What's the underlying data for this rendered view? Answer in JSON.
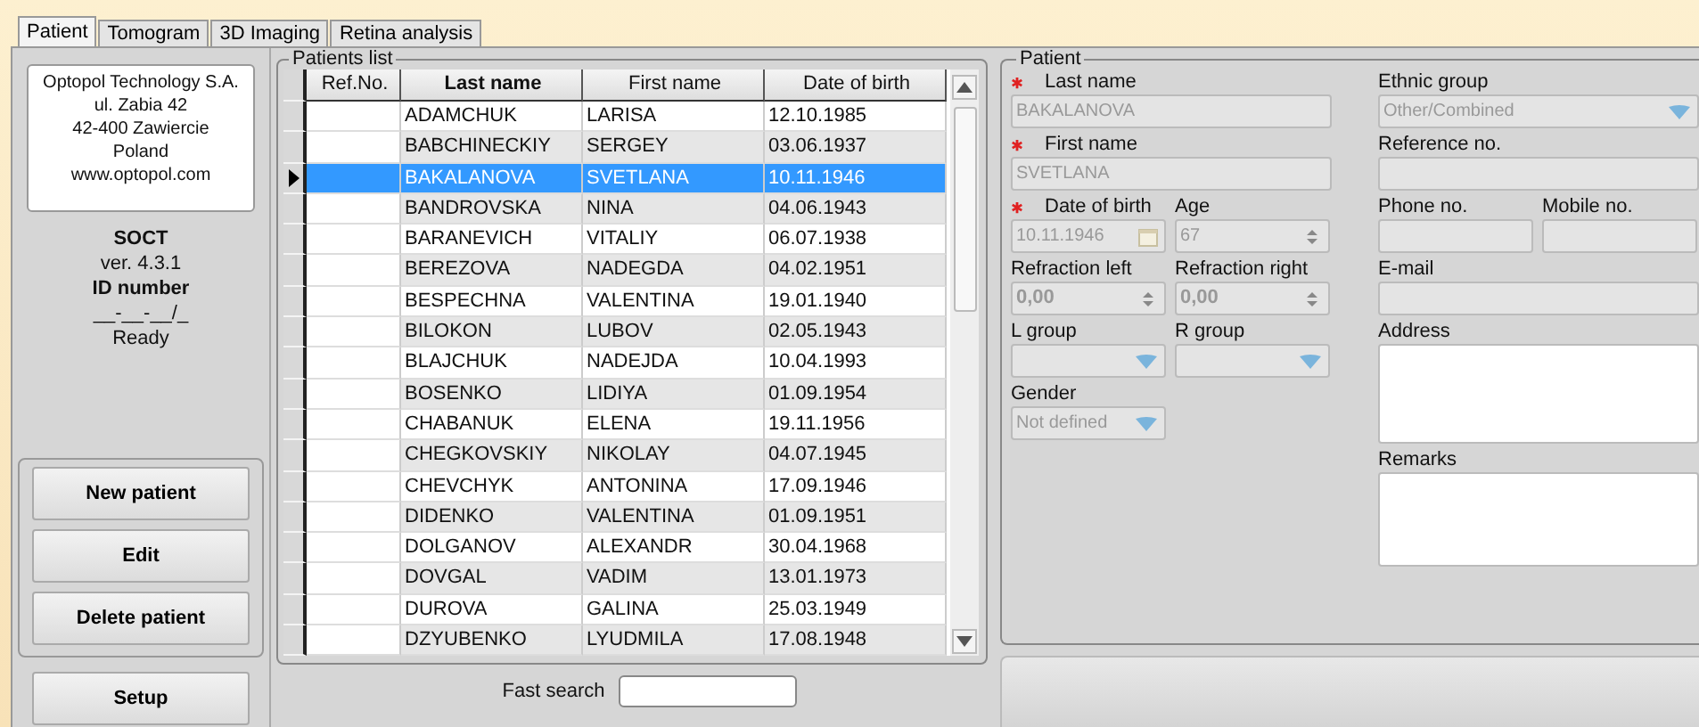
{
  "tabs": [
    {
      "label": "Patient",
      "selected": true
    },
    {
      "label": "Tomogram",
      "selected": false
    },
    {
      "label": "3D Imaging",
      "selected": false
    },
    {
      "label": "Retina analysis",
      "selected": false
    }
  ],
  "company": {
    "lines": [
      "Optopol Technology S.A.",
      "ul. Zabia 42",
      "42-400 Zawiercie",
      "Poland",
      "www.optopol.com"
    ]
  },
  "app_info": [
    {
      "text": "SOCT",
      "bold": true
    },
    {
      "text": "ver. 4.3.1",
      "bold": false
    },
    {
      "text": "ID number",
      "bold": true
    },
    {
      "text": "__-__-__/_",
      "bold": false
    },
    {
      "text": "Ready",
      "bold": false
    }
  ],
  "actions": [
    "New patient",
    "Edit",
    "Delete patient"
  ],
  "setup_button": "Setup",
  "patients_list": {
    "title": "Patients list",
    "columns": [
      {
        "label": "Ref.No.",
        "sorted": false
      },
      {
        "label": "Last name",
        "sorted": true
      },
      {
        "label": "First name",
        "sorted": false
      },
      {
        "label": "Date of birth",
        "sorted": false
      }
    ],
    "rows": [
      {
        "cells": [
          "",
          "ADAMCHUK",
          "LARISA",
          "12.10.1985"
        ],
        "selected": false
      },
      {
        "cells": [
          "",
          "BABCHINECKIY",
          "SERGEY",
          "03.06.1937"
        ],
        "selected": false
      },
      {
        "cells": [
          "",
          "BAKALANOVA",
          "SVETLANA",
          "10.11.1946"
        ],
        "selected": true
      },
      {
        "cells": [
          "",
          "BANDROVSKA",
          "NINA",
          "04.06.1943"
        ],
        "selected": false
      },
      {
        "cells": [
          "",
          "BARANEVICH",
          "VITALIY",
          "06.07.1938"
        ],
        "selected": false
      },
      {
        "cells": [
          "",
          "BEREZOVA",
          "NADEGDA",
          "04.02.1951"
        ],
        "selected": false
      },
      {
        "cells": [
          "",
          "BESPECHNA",
          "VALENTINA",
          "19.01.1940"
        ],
        "selected": false
      },
      {
        "cells": [
          "",
          "BILOKON",
          "LUBOV",
          "02.05.1943"
        ],
        "selected": false
      },
      {
        "cells": [
          "",
          "BLAJCHUK",
          "NADEJDA",
          "10.04.1993"
        ],
        "selected": false
      },
      {
        "cells": [
          "",
          "BOSENKO",
          "LIDIYA",
          "01.09.1954"
        ],
        "selected": false
      },
      {
        "cells": [
          "",
          "CHABANUK",
          "ELENA",
          "19.11.1956"
        ],
        "selected": false
      },
      {
        "cells": [
          "",
          "CHEGKOVSKIY",
          "NIKOLAY",
          "04.07.1945"
        ],
        "selected": false
      },
      {
        "cells": [
          "",
          "CHEVCHYK",
          "ANTONINA",
          "17.09.1946"
        ],
        "selected": false
      },
      {
        "cells": [
          "",
          "DIDENKO",
          "VALENTINA",
          "01.09.1951"
        ],
        "selected": false
      },
      {
        "cells": [
          "",
          "DOLGANOV",
          "ALEXANDR",
          "30.04.1968"
        ],
        "selected": false
      },
      {
        "cells": [
          "",
          "DOVGAL",
          "VADIM",
          "13.01.1973"
        ],
        "selected": false
      },
      {
        "cells": [
          "",
          "DUROVA",
          "GALINA",
          "25.03.1949"
        ],
        "selected": false
      },
      {
        "cells": [
          "",
          "DZYUBENKO",
          "LYUDMILA",
          "17.08.1948"
        ],
        "selected": false
      }
    ],
    "fast_search_label": "Fast search"
  },
  "patient": {
    "title": "Patient",
    "left_rows": [
      [
        {
          "kind": "text",
          "label": "Last name",
          "required": true,
          "value": "BAKALANOVA",
          "disabled": true
        }
      ],
      [
        {
          "kind": "text",
          "label": "First name",
          "required": true,
          "value": "SVETLANA",
          "disabled": true
        }
      ],
      [
        {
          "kind": "date",
          "label": "Date of birth",
          "required": true,
          "value": "10.11.1946",
          "disabled": true
        },
        {
          "kind": "spin",
          "label": "Age",
          "required": false,
          "value": "67",
          "disabled": true
        }
      ],
      [
        {
          "kind": "spin",
          "label": "Refraction left",
          "required": false,
          "value": "0,00",
          "disabled": true
        },
        {
          "kind": "spin",
          "label": "Refraction right",
          "required": false,
          "value": "0,00",
          "disabled": true
        }
      ],
      [
        {
          "kind": "combo",
          "label": "L group",
          "required": false,
          "disabled": true
        },
        {
          "kind": "combo",
          "label": "R group",
          "required": false,
          "disabled": true
        }
      ],
      [
        {
          "kind": "combo",
          "label": "Gender",
          "required": false,
          "value": "Not defined",
          "disabled": true
        }
      ]
    ],
    "right_rows": [
      [
        {
          "kind": "combo",
          "label": "Ethnic group",
          "required": false,
          "value": "Other/Combined",
          "disabled": true
        }
      ],
      [
        {
          "kind": "text",
          "label": "Reference no.",
          "required": false,
          "disabled": true
        }
      ],
      [
        {
          "kind": "text",
          "label": "Phone no.",
          "required": false,
          "disabled": true
        },
        {
          "kind": "text",
          "label": "Mobile no.",
          "required": false,
          "disabled": true
        }
      ],
      [
        {
          "kind": "text",
          "label": "E-mail",
          "required": false,
          "disabled": true
        }
      ],
      [
        {
          "kind": "textarea",
          "label": "Address",
          "required": false,
          "disabled": false
        }
      ],
      [
        {
          "kind": "textarea",
          "label": "Remarks",
          "required": false,
          "disabled": false
        }
      ]
    ]
  }
}
